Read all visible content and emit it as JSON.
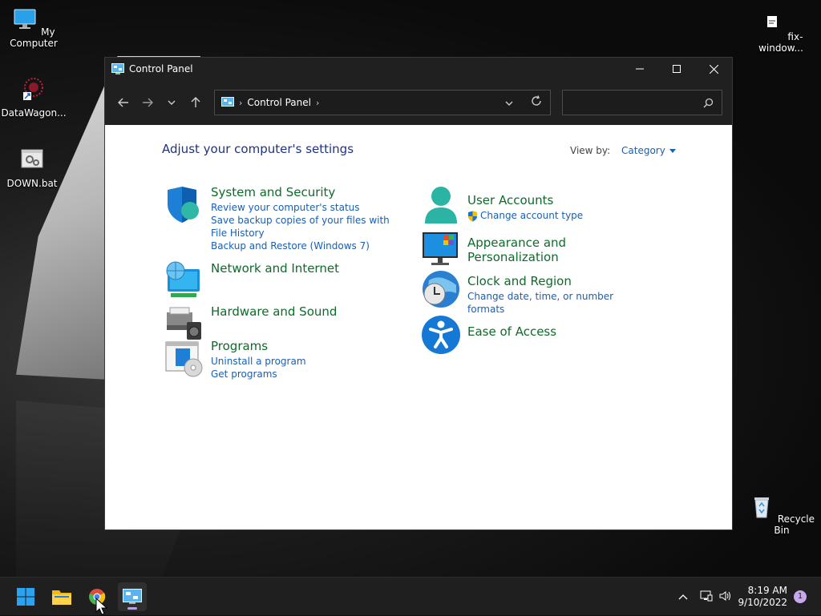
{
  "desktop": {
    "icons": [
      {
        "label": "My Computer"
      },
      {
        "label": "DataWagon..."
      },
      {
        "label": "DOWN.bat"
      },
      {
        "label": "fix-window..."
      },
      {
        "label": "Recycle Bin"
      }
    ]
  },
  "window": {
    "title": "Control Panel",
    "breadcrumb": "Control Panel",
    "search_placeholder": ""
  },
  "content": {
    "heading": "Adjust your computer's settings",
    "view_by_label": "View by:",
    "view_by_value": "Category",
    "categories": {
      "system_security": {
        "title": "System and Security",
        "links": [
          "Review your computer's status",
          "Save backup copies of your files with File History",
          "Backup and Restore (Windows 7)"
        ]
      },
      "network": {
        "title": "Network and Internet"
      },
      "hardware": {
        "title": "Hardware and Sound"
      },
      "programs": {
        "title": "Programs",
        "links": [
          "Uninstall a program",
          "Get programs"
        ]
      },
      "user_accounts": {
        "title": "User Accounts",
        "links": [
          "Change account type"
        ]
      },
      "appearance": {
        "title": "Appearance and Personalization"
      },
      "clock": {
        "title": "Clock and Region",
        "links": [
          "Change date, time, or number formats"
        ]
      },
      "ease": {
        "title": "Ease of Access"
      }
    }
  },
  "taskbar": {
    "time": "8:19 AM",
    "date": "9/10/2022",
    "notification_count": "1"
  },
  "colors": {
    "category_title": "#0e6b2a",
    "link": "#1a5fb4",
    "heading": "#1e3287",
    "titlebar": "#202020"
  }
}
